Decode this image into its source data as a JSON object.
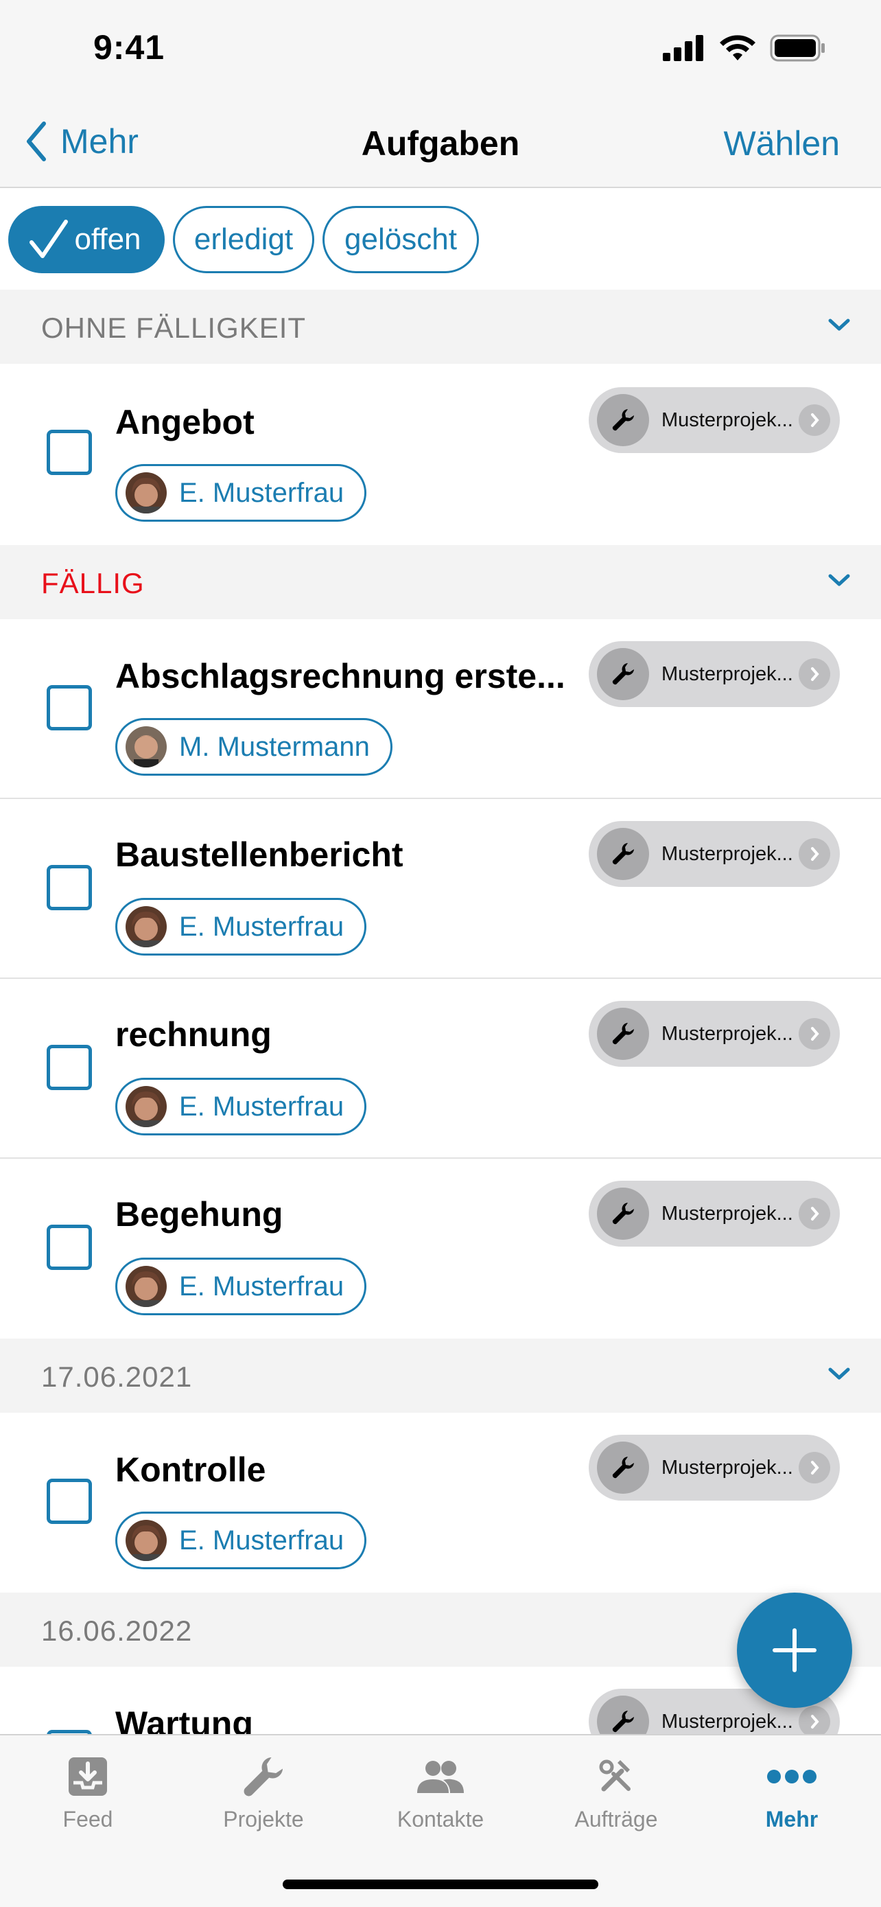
{
  "status_bar": {
    "time": "9:41"
  },
  "nav": {
    "back_label": "Mehr",
    "title": "Aufgaben",
    "action_label": "Wählen"
  },
  "filters": [
    {
      "label": "offen",
      "active": true
    },
    {
      "label": "erledigt",
      "active": false
    },
    {
      "label": "gelöscht",
      "active": false
    }
  ],
  "sections": [
    {
      "title": "OHNE FÄLLIGKEIT",
      "tasks": [
        {
          "title": "Angebot",
          "assignee": "E. Musterfrau",
          "project": "Musterprojek..."
        }
      ]
    },
    {
      "title": "FÄLLIG",
      "tasks": [
        {
          "title": "Abschlagsrechnung erste...",
          "assignee": "M. Mustermann",
          "project": "Musterprojek..."
        },
        {
          "title": "Baustellenbericht",
          "assignee": "E. Musterfrau",
          "project": "Musterprojek..."
        },
        {
          "title": "rechnung",
          "assignee": "E. Musterfrau",
          "project": "Musterprojek..."
        },
        {
          "title": "Begehung",
          "assignee": "E. Musterfrau",
          "project": "Musterprojek..."
        }
      ]
    },
    {
      "title": "17.06.2021",
      "tasks": [
        {
          "title": "Kontrolle",
          "assignee": "E. Musterfrau",
          "project": "Musterprojek..."
        }
      ]
    },
    {
      "title": "16.06.2022",
      "tasks": [
        {
          "title": "Wartung",
          "project": "Musterprojek..."
        }
      ]
    }
  ],
  "tabs": [
    {
      "label": "Feed",
      "icon": "feed-icon"
    },
    {
      "label": "Projekte",
      "icon": "wrench-icon"
    },
    {
      "label": "Kontakte",
      "icon": "contacts-icon"
    },
    {
      "label": "Aufträge",
      "icon": "tools-icon"
    },
    {
      "label": "Mehr",
      "icon": "more-icon",
      "active": true
    }
  ],
  "colors": {
    "accent": "#1b7db1",
    "due": "#e8101a",
    "section_bg": "#f3f3f3"
  }
}
